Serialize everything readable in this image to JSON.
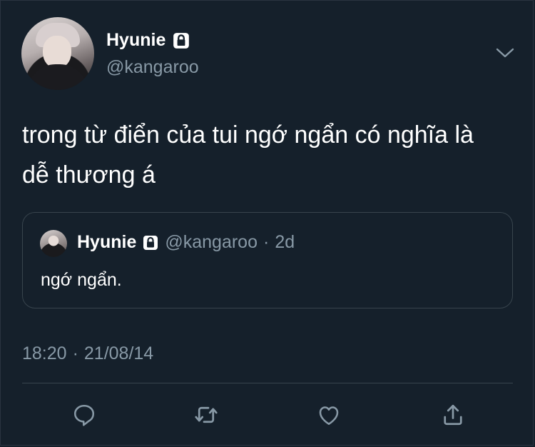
{
  "tweet": {
    "author": {
      "display_name": "Hyunie",
      "handle": "@kangaroo",
      "protected_icon": "lock-icon"
    },
    "text": "trong từ điển của tui ngớ ngẩn có nghĩa là dễ thương á",
    "timestamp": "18:20",
    "date": "21/08/14",
    "separator": "·"
  },
  "quoted_tweet": {
    "display_name": "Hyunie",
    "handle": "@kangaroo",
    "separator": "·",
    "age": "2d",
    "text": "ngớ ngẩn."
  },
  "actions": {
    "icons": [
      "reply-icon",
      "retweet-icon",
      "like-icon",
      "share-icon"
    ]
  },
  "colors": {
    "background": "#15202b",
    "secondary_text": "#8899a6",
    "border": "#38444d",
    "primary_text": "#ffffff"
  }
}
